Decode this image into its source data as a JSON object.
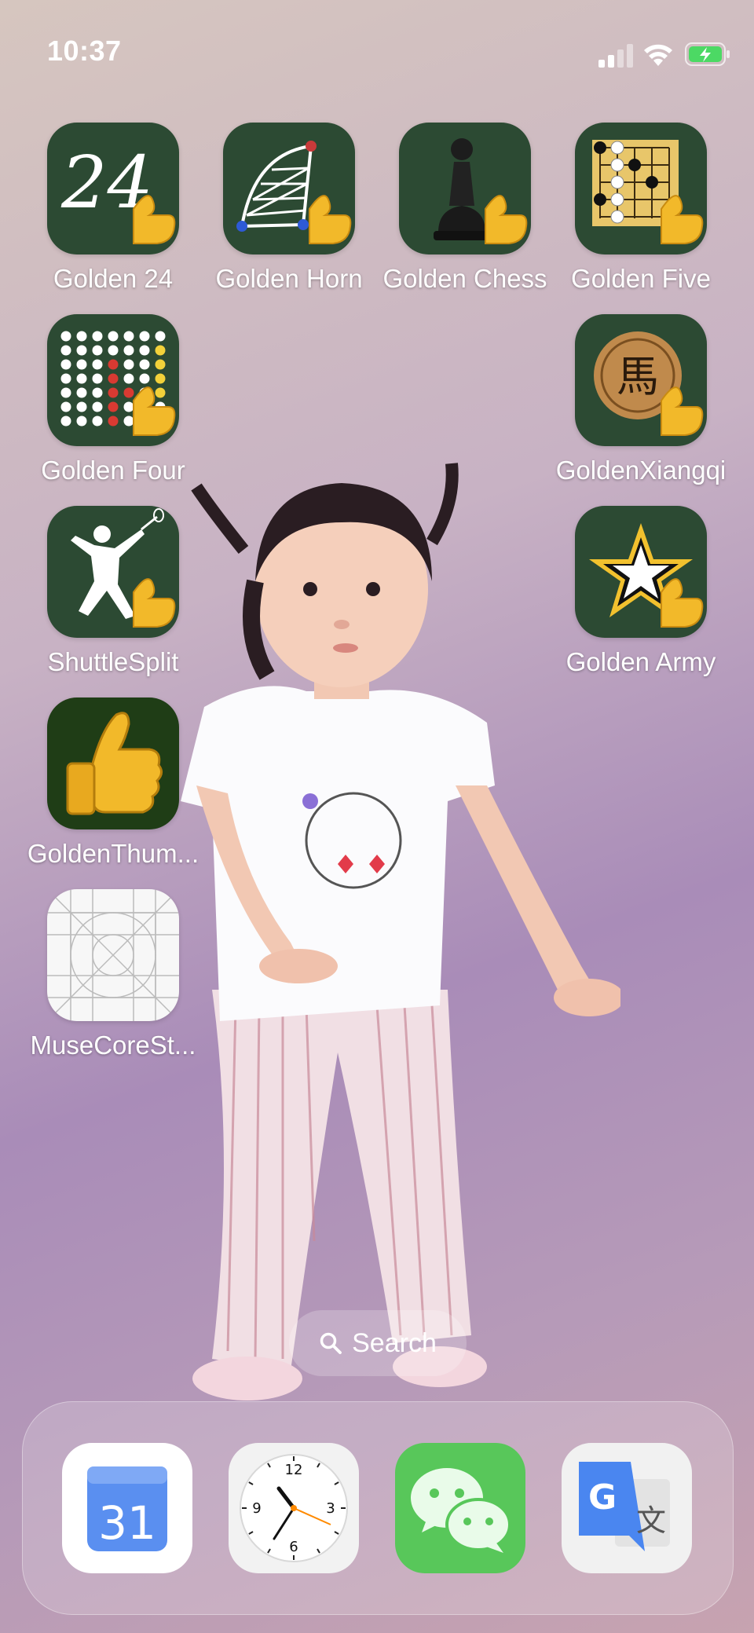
{
  "status_bar": {
    "time": "10:37",
    "signal_icon": "cellular-signal-icon",
    "wifi_icon": "wifi-icon",
    "battery_icon": "battery-charging-icon",
    "battery_color": "#4cd964"
  },
  "apps": [
    {
      "label": "Golden 24",
      "icon": "golden-24-icon",
      "text": "24"
    },
    {
      "label": "Golden Horn",
      "icon": "golden-horn-icon"
    },
    {
      "label": "Golden Chess",
      "icon": "chess-pawn-icon"
    },
    {
      "label": "Golden Five",
      "icon": "gomoku-board-icon"
    },
    {
      "label": "Golden Four",
      "icon": "connect-four-icon"
    },
    {
      "label": "GoldenXiangqi",
      "icon": "xiangqi-horse-icon",
      "text": "馬"
    },
    {
      "label": "ShuttleSplit",
      "icon": "badminton-player-icon"
    },
    {
      "label": "Golden Army",
      "icon": "army-star-icon"
    },
    {
      "label": "GoldenThum...",
      "icon": "thumbs-up-icon"
    },
    {
      "label": "MuseCoreSt...",
      "icon": "app-template-grid-icon"
    }
  ],
  "search": {
    "label": "Search",
    "icon": "search-icon"
  },
  "dock": [
    {
      "name": "calendar",
      "icon": "calendar-icon",
      "text": "31"
    },
    {
      "name": "clock",
      "icon": "clock-icon",
      "numbers": [
        "12",
        "3",
        "6",
        "9"
      ]
    },
    {
      "name": "wechat",
      "icon": "wechat-icon"
    },
    {
      "name": "translate",
      "icon": "google-translate-icon",
      "text_g": "G",
      "text_zh": "文"
    }
  ],
  "colors": {
    "icon_green": "#2c4a33",
    "thumb_gold": "#f2b92a",
    "clock_accent": "#ff8a00",
    "wechat_green": "#58c75a"
  }
}
